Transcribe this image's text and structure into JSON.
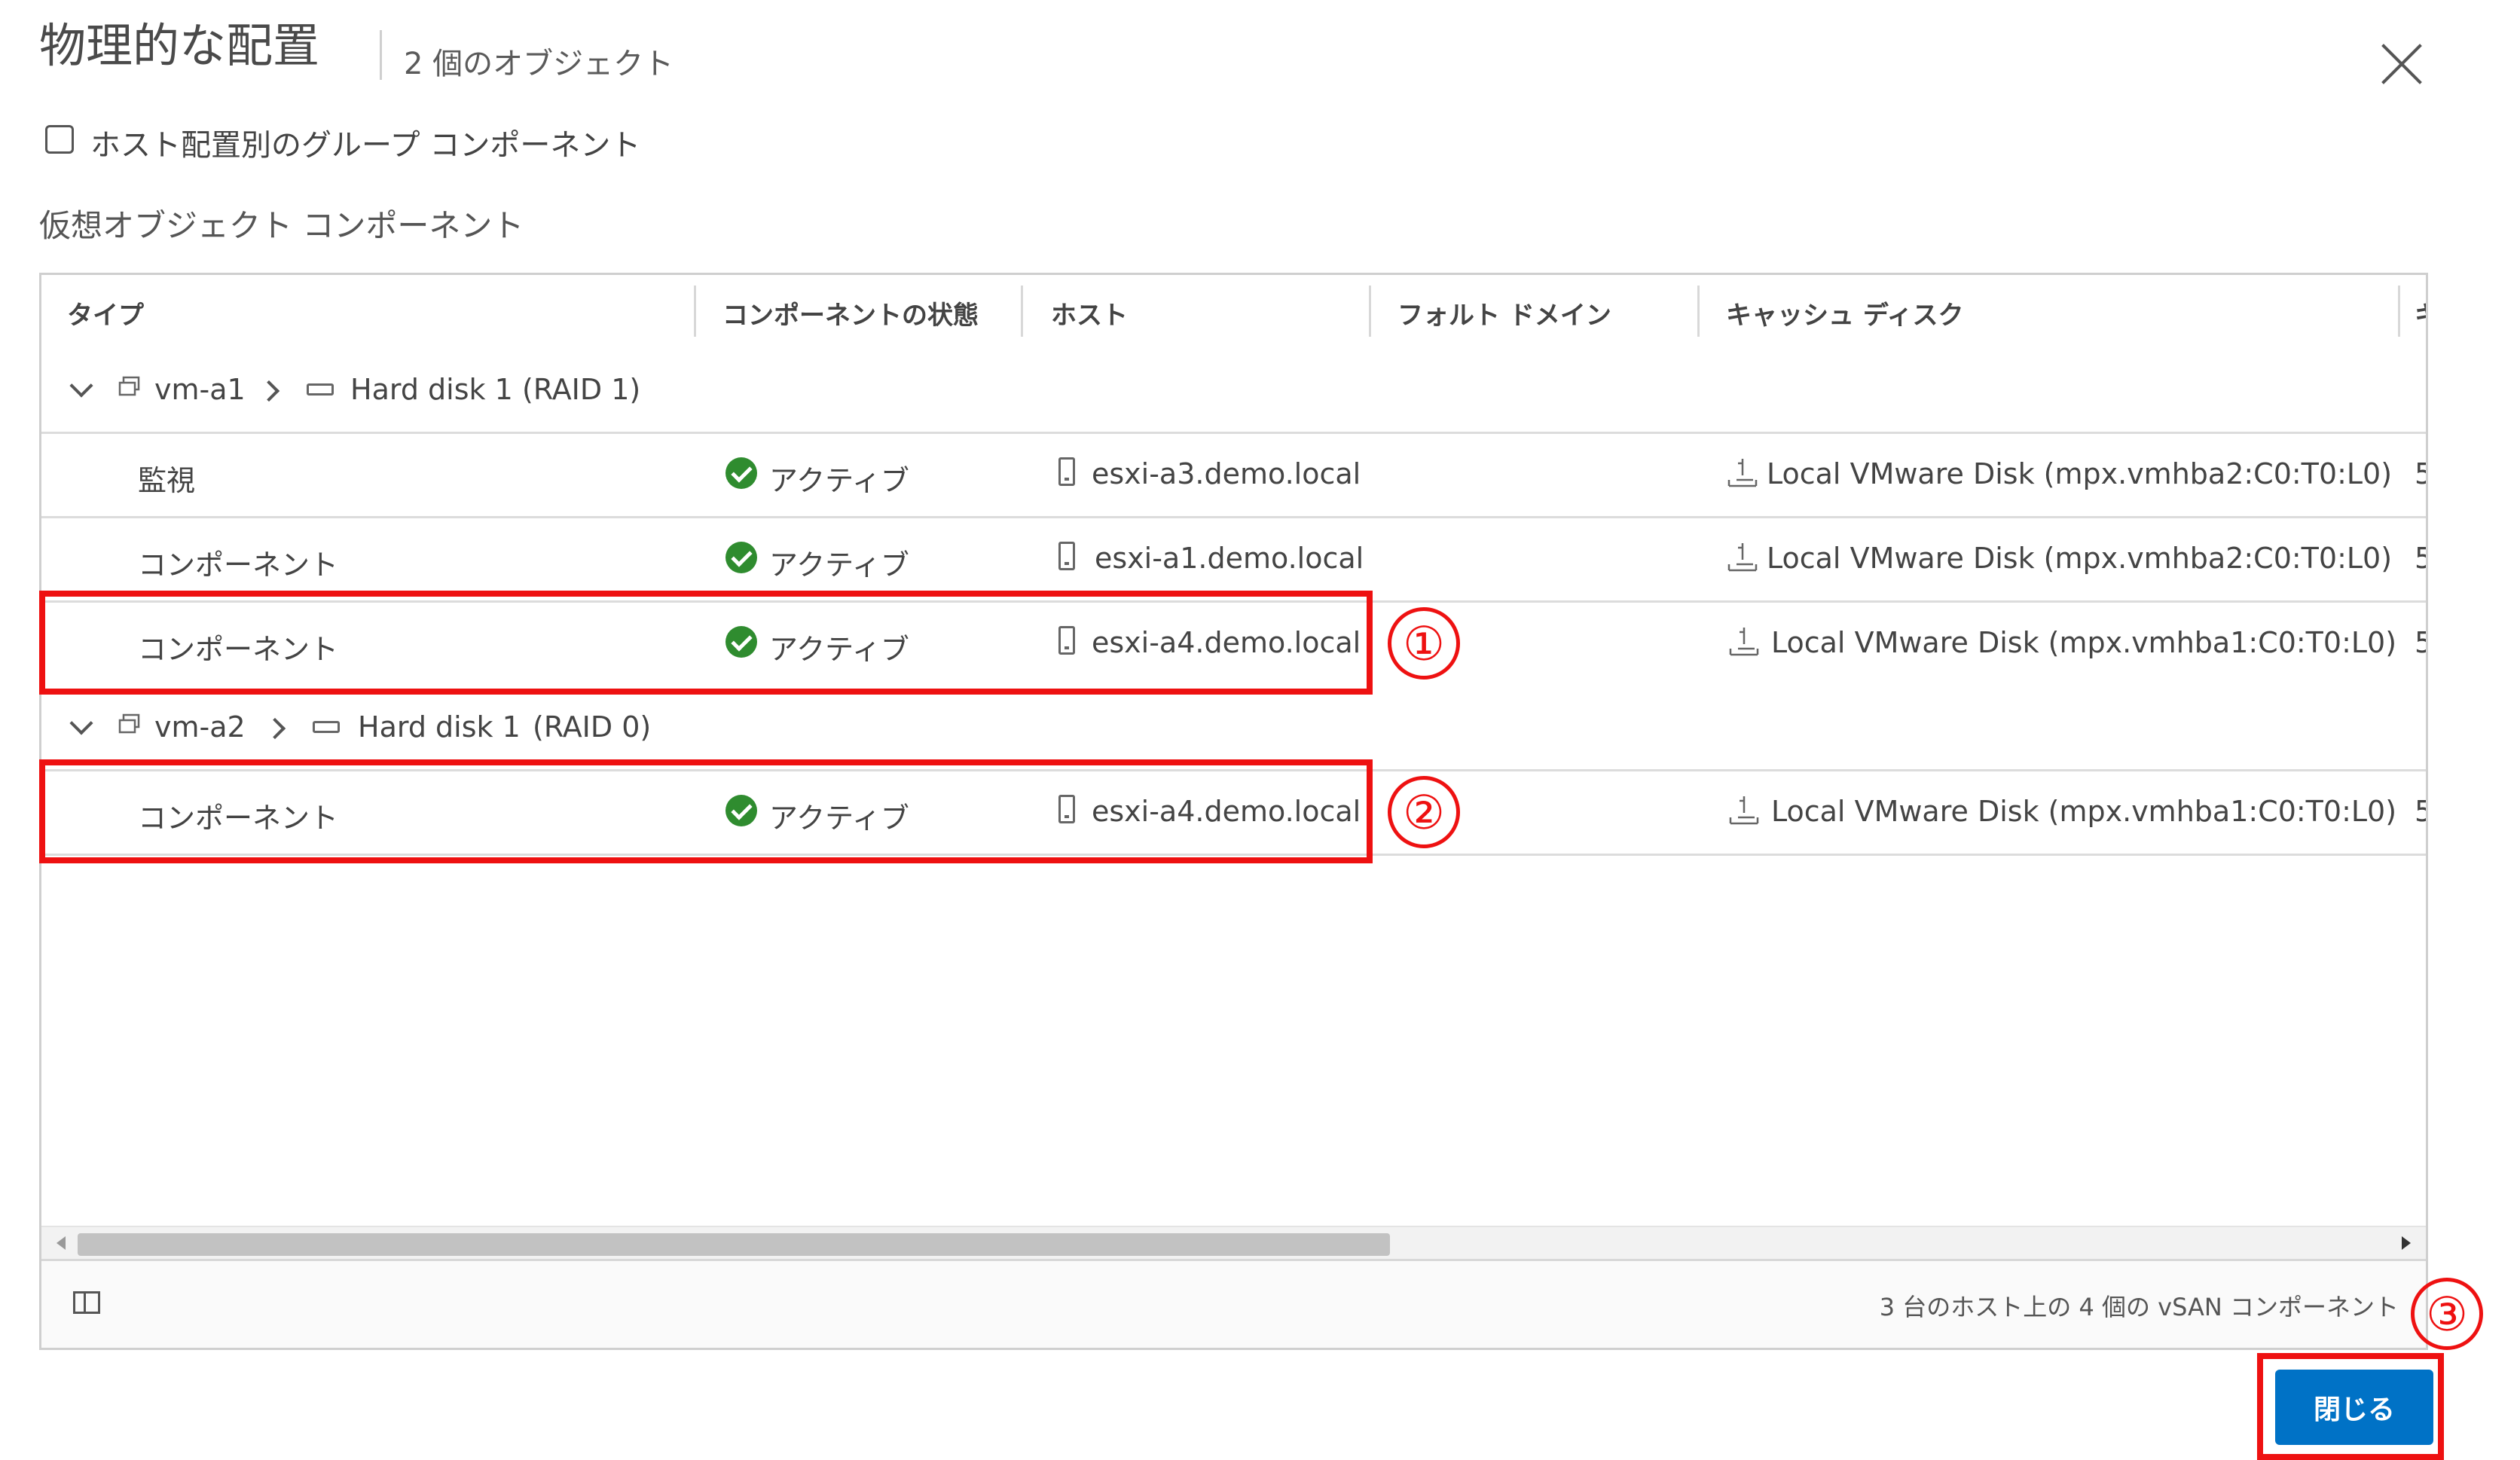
{
  "dialog": {
    "title": "物理的な配置",
    "subtitle": "2 個のオブジェクト"
  },
  "options": {
    "group_by_host_label": "ホスト配置別のグループ コンポーネント",
    "group_by_host_checked": false
  },
  "section_label": "仮想オブジェクト コンポーネント",
  "grid": {
    "columns": [
      "タイプ",
      "コンポーネントの状態",
      "ホスト",
      "フォルト ドメイン",
      "キャッシュ ディスク",
      "キ"
    ],
    "groups": [
      {
        "vm": "vm-a1",
        "disk": "Hard disk 1",
        "raid": "(RAID 1)",
        "rows": [
          {
            "type": "監視",
            "state": "アクティブ",
            "host": "esxi-a3.demo.local",
            "fault_domain": "",
            "cache_disk": "Local VMware Disk (mpx.vmhba2:C0:T0:L0)",
            "next": "5"
          },
          {
            "type": "コンポーネント",
            "state": "アクティブ",
            "host": "esxi-a1.demo.local",
            "fault_domain": "",
            "cache_disk": "Local VMware Disk (mpx.vmhba2:C0:T0:L0)",
            "next": "5"
          },
          {
            "type": "コンポーネント",
            "state": "アクティブ",
            "host": "esxi-a4.demo.local",
            "fault_domain": "",
            "cache_disk": "Local VMware Disk (mpx.vmhba1:C0:T0:L0)",
            "next": "5"
          }
        ]
      },
      {
        "vm": "vm-a2",
        "disk": "Hard disk 1",
        "raid": "(RAID 0)",
        "rows": [
          {
            "type": "コンポーネント",
            "state": "アクティブ",
            "host": "esxi-a4.demo.local",
            "fault_domain": "",
            "cache_disk": "Local VMware Disk (mpx.vmhba1:C0:T0:L0)",
            "next": "5"
          }
        ]
      }
    ],
    "footer_count": "3 台のホスト上の 4 個の vSAN コンポーネント"
  },
  "buttons": {
    "close": "閉じる"
  },
  "annotations": [
    "①",
    "②",
    "③"
  ],
  "colors": {
    "primary_button": "#0072c6",
    "status_ok": "#2f8c2f",
    "annotation": "#ee1111"
  }
}
